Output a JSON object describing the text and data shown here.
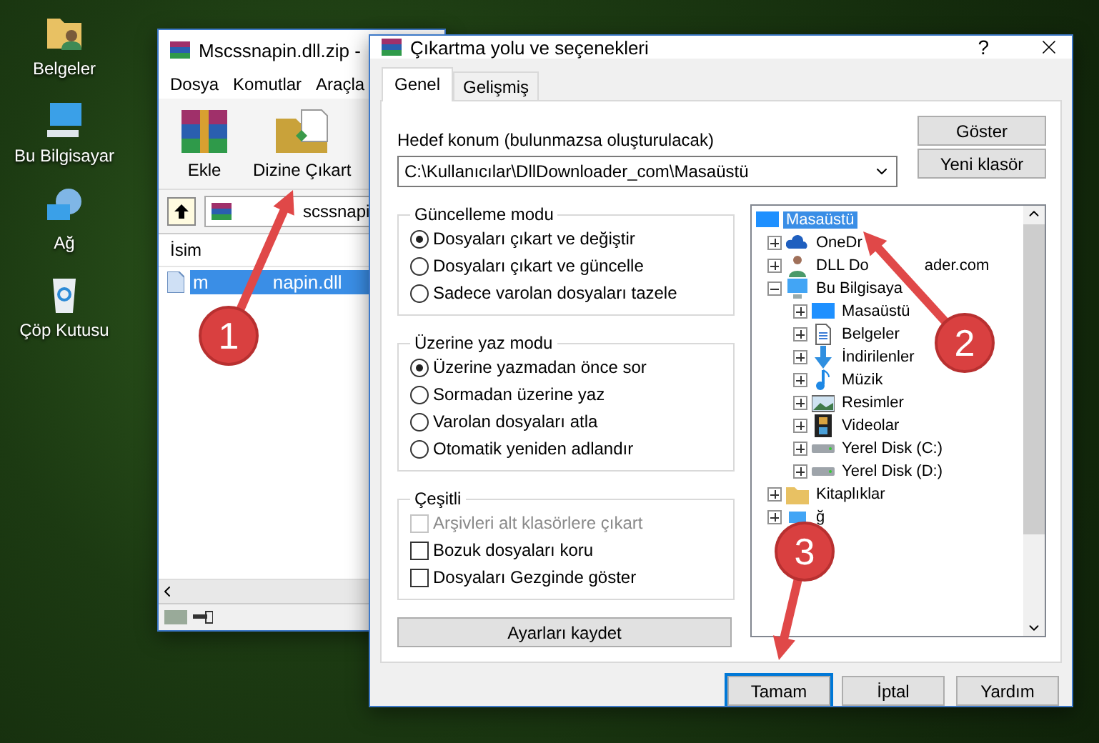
{
  "desktop_icons": [
    {
      "label": "Belgeler",
      "kind": "folder"
    },
    {
      "label": "Bu Bilgisayar",
      "kind": "computer"
    },
    {
      "label": "Ağ",
      "kind": "network"
    },
    {
      "label": "Çöp Kutusu",
      "kind": "recycle"
    }
  ],
  "archiver": {
    "title": "Mscssnapin.dll.zip -",
    "menu": [
      "Dosya",
      "Komutlar",
      "Araçla"
    ],
    "toolbar": [
      {
        "label": "Ekle",
        "kind": "add"
      },
      {
        "label": "Dizine Çıkart",
        "kind": "extract"
      }
    ],
    "address": "scssnapi",
    "columns": [
      "İsim"
    ],
    "files": [
      {
        "name": "m",
        "name_tail": "napin.dll",
        "selected": true
      }
    ]
  },
  "dialog": {
    "title": "Çıkartma yolu ve seçenekleri",
    "help": "?",
    "tabs": [
      {
        "label": "Genel",
        "selected": true
      },
      {
        "label": "Gelişmiş",
        "selected": false
      }
    ],
    "destination": {
      "label": "Hedef konum (bulunmazsa oluşturulacak)",
      "value": "C:\\Kullanıcılar\\DllDownloader_com\\Masaüstü"
    },
    "side_buttons": [
      "Göster",
      "Yeni klasör"
    ],
    "groups": [
      {
        "title": "Güncelleme modu",
        "options": [
          {
            "kind": "radio",
            "label": "Dosyaları çıkart ve değiştir",
            "checked": true,
            "disabled": false
          },
          {
            "kind": "radio",
            "label": "Dosyaları çıkart ve güncelle",
            "checked": false,
            "disabled": false
          },
          {
            "kind": "radio",
            "label": "Sadece varolan dosyaları tazele",
            "checked": false,
            "disabled": false
          }
        ]
      },
      {
        "title": "Üzerine yaz modu",
        "options": [
          {
            "kind": "radio",
            "label": "Üzerine yazmadan önce sor",
            "checked": true,
            "disabled": false
          },
          {
            "kind": "radio",
            "label": "Sormadan üzerine yaz",
            "checked": false,
            "disabled": false
          },
          {
            "kind": "radio",
            "label": "Varolan dosyaları atla",
            "checked": false,
            "disabled": false
          },
          {
            "kind": "radio",
            "label": "Otomatik yeniden adlandır",
            "checked": false,
            "disabled": false
          }
        ]
      },
      {
        "title": "Çeşitli",
        "options": [
          {
            "kind": "checkbox",
            "label": "Arşivleri alt klasörlere çıkart",
            "checked": false,
            "disabled": true
          },
          {
            "kind": "checkbox",
            "label": "Bozuk dosyaları koru",
            "checked": false,
            "disabled": false
          },
          {
            "kind": "checkbox",
            "label": "Dosyaları Gezginde göster",
            "checked": false,
            "disabled": false
          }
        ]
      }
    ],
    "save_button": "Ayarları kaydet",
    "tree": [
      {
        "label": "Masaüstü",
        "kind": "desktop",
        "selected": true,
        "children": [
          {
            "label": "OneDr",
            "kind": "cloud",
            "selected": false,
            "expanded": false
          },
          {
            "label": "DLL Do",
            "label_tail": "ader.com",
            "kind": "user",
            "selected": false,
            "expanded": false
          },
          {
            "label": "Bu Bilgisaya",
            "kind": "computer",
            "selected": false,
            "expanded": true,
            "children": [
              {
                "label": "Masaüstü",
                "kind": "desktop",
                "selected": false,
                "expanded": false
              },
              {
                "label": "Belgeler",
                "kind": "document",
                "selected": false,
                "expanded": false
              },
              {
                "label": "İndirilenler",
                "kind": "download",
                "selected": false,
                "expanded": false
              },
              {
                "label": "Müzik",
                "kind": "music",
                "selected": false,
                "expanded": false
              },
              {
                "label": "Resimler",
                "kind": "picture",
                "selected": false,
                "expanded": false
              },
              {
                "label": "Videolar",
                "kind": "video",
                "selected": false,
                "expanded": false
              },
              {
                "label": "Yerel Disk (C:)",
                "kind": "drive",
                "selected": false,
                "expanded": false
              },
              {
                "label": "Yerel Disk (D:)",
                "kind": "drive",
                "selected": false,
                "expanded": false
              }
            ]
          },
          {
            "label": "Kitaplıklar",
            "kind": "library",
            "selected": false,
            "expanded": false
          },
          {
            "label": "ğ",
            "kind": "network",
            "selected": false,
            "expanded": false
          }
        ]
      }
    ],
    "buttons": [
      {
        "label": "Tamam",
        "default": true
      },
      {
        "label": "İptal",
        "default": false
      },
      {
        "label": "Yardım",
        "default": false
      }
    ]
  },
  "annotations": [
    {
      "number": "1"
    },
    {
      "number": "2"
    },
    {
      "number": "3"
    }
  ]
}
